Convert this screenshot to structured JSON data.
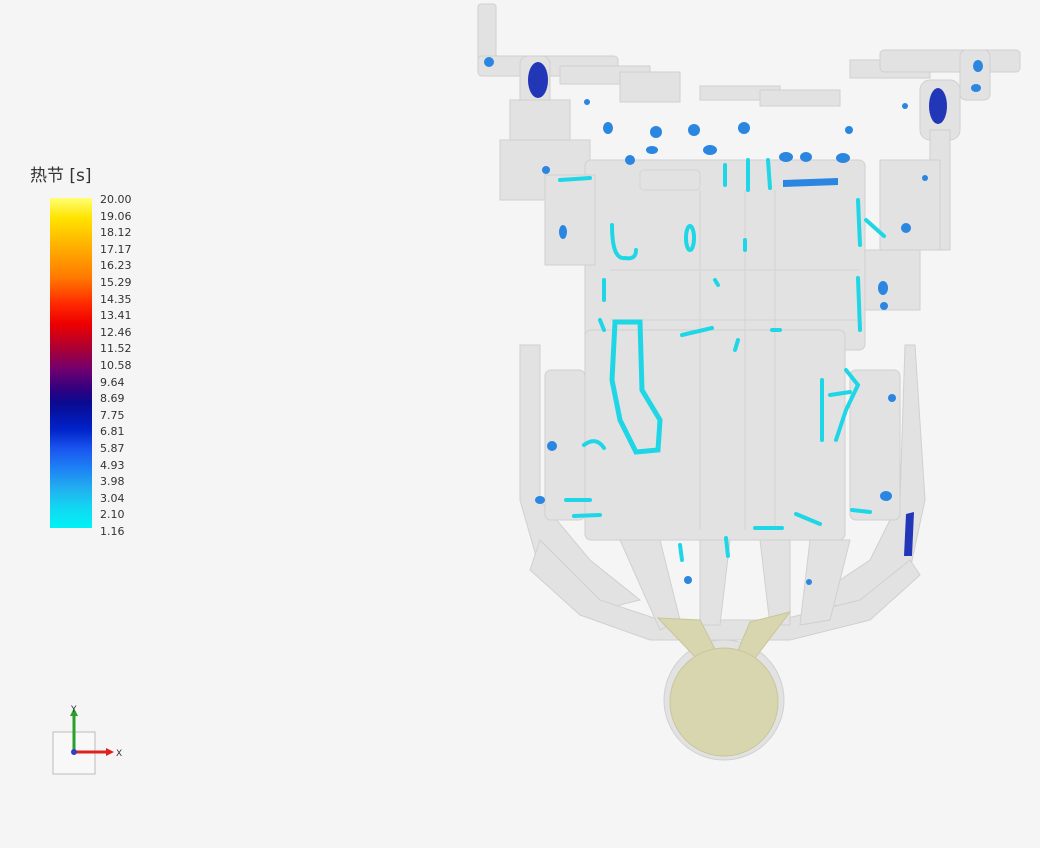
{
  "legend": {
    "title": "热节 [s]",
    "ticks": [
      "20.00",
      "19.06",
      "18.12",
      "17.17",
      "16.23",
      "15.29",
      "14.35",
      "13.41",
      "12.46",
      "11.52",
      "10.58",
      "9.64",
      "8.69",
      "7.75",
      "6.81",
      "5.87",
      "4.93",
      "3.98",
      "3.04",
      "2.10",
      "1.16"
    ],
    "colors": {
      "high": "#ffff73",
      "mid": "#b1002f",
      "low": "#00f2f5"
    }
  },
  "axes": {
    "y_label": "Y",
    "x_label": "X"
  },
  "model": {
    "part_color": "#e2e2e2",
    "hotspot_color_low": "#1fd6e6",
    "hotspot_color_mid": "#2a86e0",
    "hotspot_color_high": "#2236b8",
    "biscuit_color": "#d8d6ae"
  }
}
